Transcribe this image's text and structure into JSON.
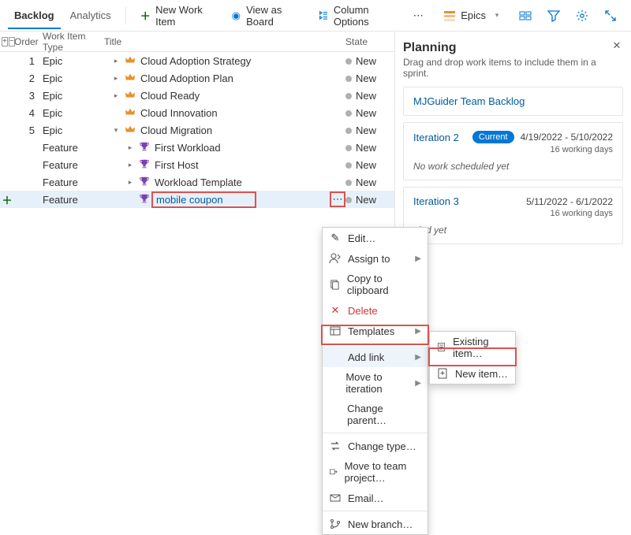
{
  "tabs": {
    "backlog": "Backlog",
    "analytics": "Analytics"
  },
  "toolbar": {
    "new_work_item": "New Work Item",
    "view_as_board": "View as Board",
    "column_options": "Column Options",
    "level": "Epics"
  },
  "columns": {
    "order": "Order",
    "type": "Work Item Type",
    "title": "Title",
    "state": "State"
  },
  "rows": [
    {
      "order": "1",
      "type": "Epic",
      "indent": 0,
      "icon": "crown",
      "chev": "right",
      "title": "Cloud Adoption Strategy",
      "state": "New",
      "interactable": true
    },
    {
      "order": "2",
      "type": "Epic",
      "indent": 0,
      "icon": "crown",
      "chev": "right",
      "title": "Cloud Adoption Plan",
      "state": "New",
      "interactable": true
    },
    {
      "order": "3",
      "type": "Epic",
      "indent": 0,
      "icon": "crown",
      "chev": "right",
      "title": "Cloud Ready",
      "state": "New",
      "interactable": true
    },
    {
      "order": "4",
      "type": "Epic",
      "indent": 0,
      "icon": "crown",
      "chev": "none",
      "title": "Cloud Innovation",
      "state": "New",
      "interactable": true
    },
    {
      "order": "5",
      "type": "Epic",
      "indent": 0,
      "icon": "crown",
      "chev": "down",
      "title": "Cloud Migration",
      "state": "New",
      "interactable": true
    },
    {
      "order": "",
      "type": "Feature",
      "indent": 1,
      "icon": "trophy",
      "chev": "right",
      "title": "First Workload",
      "state": "New",
      "interactable": true
    },
    {
      "order": "",
      "type": "Feature",
      "indent": 1,
      "icon": "trophy",
      "chev": "right",
      "title": "First Host",
      "state": "New",
      "interactable": true
    },
    {
      "order": "",
      "type": "Feature",
      "indent": 1,
      "icon": "trophy",
      "chev": "right",
      "title": "Workload Template",
      "state": "New",
      "interactable": true
    },
    {
      "order": "",
      "type": "Feature",
      "indent": 1,
      "icon": "trophy",
      "chev": "none",
      "title": "mobile coupon",
      "state": "New",
      "interactable": true,
      "selected": true,
      "showadd": true,
      "redbox": true
    }
  ],
  "menu": {
    "edit": "Edit…",
    "assign": "Assign to",
    "copy": "Copy to clipboard",
    "delete": "Delete",
    "templates": "Templates",
    "addlink": "Add link",
    "move_iter": "Move to iteration",
    "change_parent": "Change parent…",
    "change_type": "Change type…",
    "move_proj": "Move to team project…",
    "email": "Email…",
    "branch": "New branch…"
  },
  "submenu": {
    "existing": "Existing item…",
    "new": "New item…"
  },
  "planning": {
    "title": "Planning",
    "subtitle": "Drag and drop work items to include them in a sprint.",
    "backlog": "MJGuider Team Backlog",
    "iterations": [
      {
        "name": "Iteration 2",
        "current": true,
        "badge": "Current",
        "dates": "4/19/2022 - 5/10/2022",
        "days": "16 working days",
        "empty": "No work scheduled yet"
      },
      {
        "name": "Iteration 3",
        "current": false,
        "dates": "5/11/2022 - 6/1/2022",
        "days": "16 working days",
        "empty": "uled yet"
      }
    ]
  }
}
